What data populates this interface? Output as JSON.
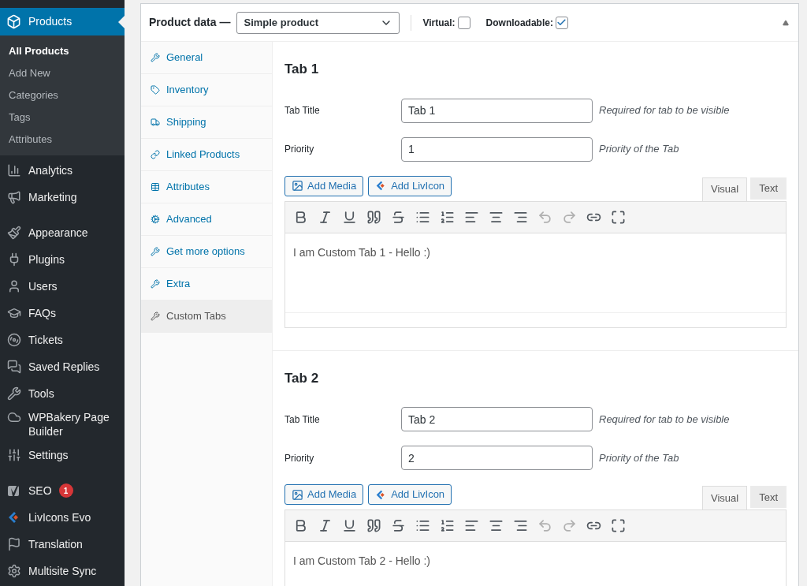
{
  "sidebar": {
    "current": {
      "label": "Products",
      "selected": true
    },
    "submenu": [
      {
        "label": "All Products",
        "selected": true
      },
      {
        "label": "Add New",
        "selected": false
      },
      {
        "label": "Categories",
        "selected": false
      },
      {
        "label": "Tags",
        "selected": false
      },
      {
        "label": "Attributes",
        "selected": false
      }
    ],
    "items": [
      {
        "label": "Analytics"
      },
      {
        "label": "Marketing"
      },
      {
        "label": "Appearance"
      },
      {
        "label": "Plugins"
      },
      {
        "label": "Users"
      },
      {
        "label": "FAQs"
      },
      {
        "label": "Tickets"
      },
      {
        "label": "Saved Replies"
      },
      {
        "label": "Tools"
      },
      {
        "label": "WPBakery Page Builder"
      },
      {
        "label": "Settings"
      },
      {
        "label": "SEO",
        "badge": "1"
      },
      {
        "label": "LivIcons Evo"
      },
      {
        "label": "Translation"
      },
      {
        "label": "Multisite Sync"
      }
    ]
  },
  "product_data": {
    "title": "Product data —",
    "type": "Simple product",
    "virtual": {
      "label": "Virtual:",
      "checked": false
    },
    "downloadable": {
      "label": "Downloadable:",
      "checked": true
    },
    "tabs": [
      {
        "label": "General",
        "selected": false
      },
      {
        "label": "Inventory",
        "selected": false
      },
      {
        "label": "Shipping",
        "selected": false
      },
      {
        "label": "Linked Products",
        "selected": false
      },
      {
        "label": "Attributes",
        "selected": false
      },
      {
        "label": "Advanced",
        "selected": false
      },
      {
        "label": "Get more options",
        "selected": false
      },
      {
        "label": "Extra",
        "selected": false
      },
      {
        "label": "Custom Tabs",
        "selected": true
      }
    ],
    "custom_tabs": [
      {
        "heading": "Tab 1",
        "fields": [
          {
            "label": "Tab Title",
            "value": "Tab 1",
            "hint": "Required for tab to be visible"
          },
          {
            "label": "Priority",
            "value": "1",
            "hint": "Priority of the Tab"
          }
        ],
        "buttons": [
          "Add Media",
          "Add LivIcon"
        ],
        "editor_tabs": [
          {
            "label": "Visual",
            "selected": true
          },
          {
            "label": "Text",
            "selected": false
          }
        ],
        "content": "I am Custom Tab 1 - Hello :)"
      },
      {
        "heading": "Tab 2",
        "fields": [
          {
            "label": "Tab Title",
            "value": "Tab 2",
            "hint": "Required for tab to be visible"
          },
          {
            "label": "Priority",
            "value": "2",
            "hint": "Priority of the Tab"
          }
        ],
        "buttons": [
          "Add Media",
          "Add LivIcon"
        ],
        "editor_tabs": [
          {
            "label": "Visual",
            "selected": true
          },
          {
            "label": "Text",
            "selected": false
          }
        ],
        "content": "I am Custom Tab 2 - Hello :)"
      }
    ]
  }
}
